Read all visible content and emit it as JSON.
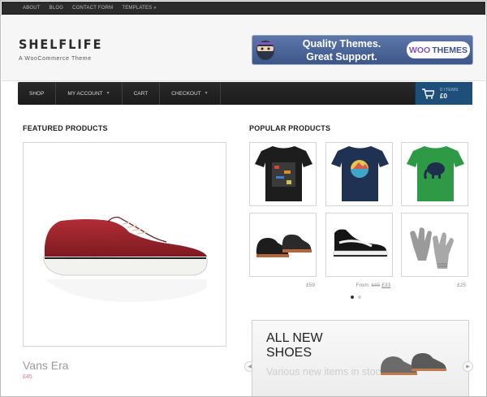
{
  "topnav": {
    "links": [
      "ABOUT",
      "BLOG",
      "CONTACT FORM",
      "TEMPLATES »"
    ]
  },
  "header": {
    "title": "SHELFLIFE",
    "tagline": "A WooCommerce Theme",
    "banner": {
      "line1": "Quality Themes.",
      "line2": "Great Support.",
      "logo_woo": "WOO",
      "logo_themes": "THEMES"
    }
  },
  "nav": {
    "items": [
      {
        "label": "SHOP",
        "has_caret": false
      },
      {
        "label": "MY ACCOUNT",
        "has_caret": true
      },
      {
        "label": "CART",
        "has_caret": false
      },
      {
        "label": "CHECKOUT",
        "has_caret": true
      }
    ],
    "cart": {
      "items_label": "0 ITEMS",
      "total": "£0"
    }
  },
  "featured": {
    "heading": "FEATURED PRODUCTS",
    "product": {
      "name": "Vans Era",
      "price": "£45"
    }
  },
  "popular": {
    "heading": "POPULAR PRODUCTS",
    "prices": [
      {
        "text": "£59"
      },
      {
        "from": "From:",
        "old": "£65",
        "new": "£33"
      },
      {
        "text": "£25"
      }
    ],
    "active_slide": 1,
    "slide_count": 2
  },
  "promo": {
    "line1": "ALL NEW",
    "line2": "SHOES",
    "subtitle": "Various new items in stock"
  },
  "colors": {
    "topbar": "#2b2b2b",
    "nav": "#1f1f1f",
    "cart": "#1e4e7a",
    "price_accent": "#d9788e",
    "banner": "#4a6598"
  },
  "icons": [
    "ninja-icon",
    "chevron-down-icon",
    "cart-icon",
    "arrow-left-icon",
    "arrow-right-icon"
  ]
}
